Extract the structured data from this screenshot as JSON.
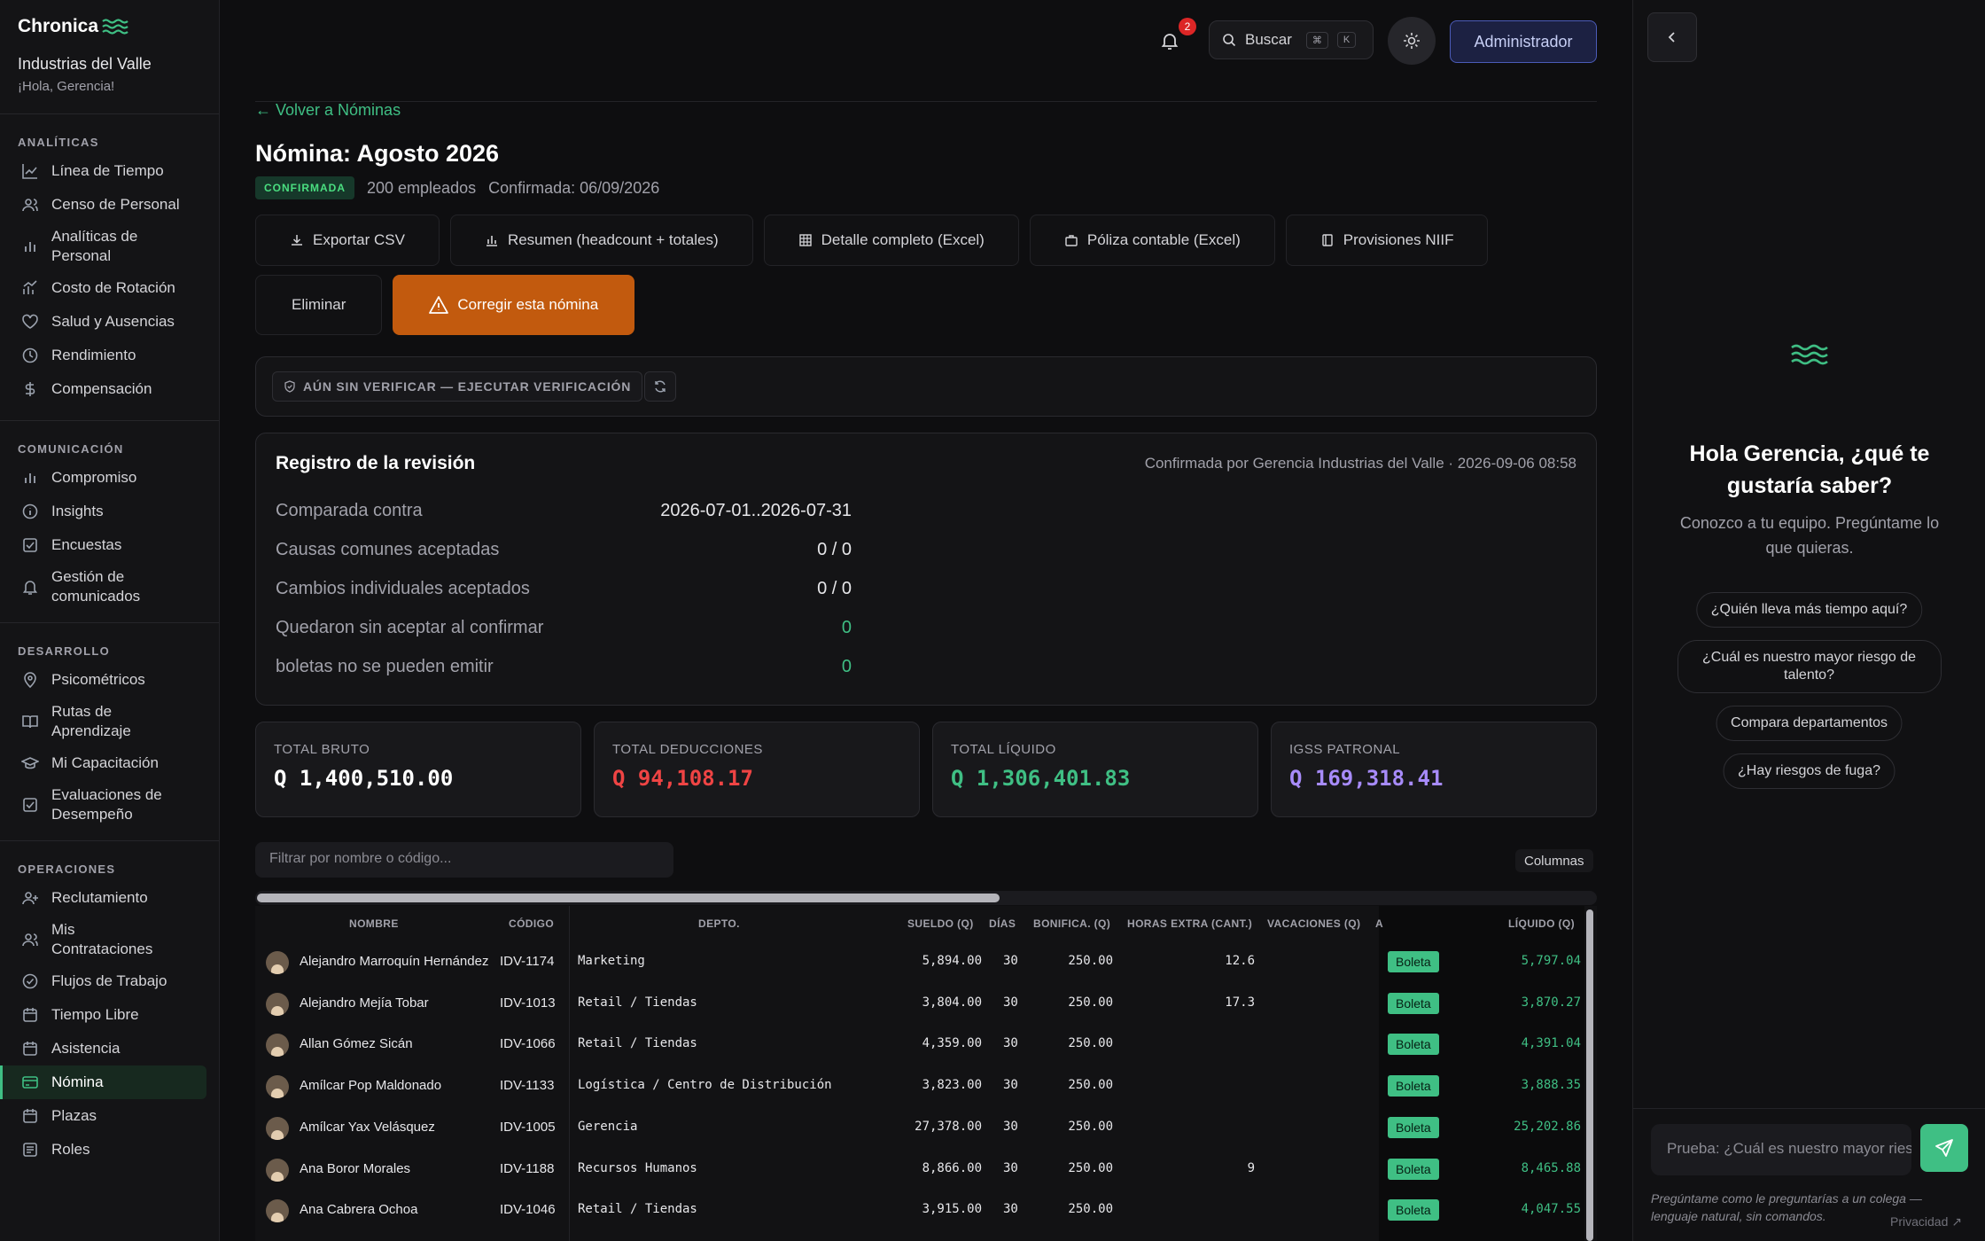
{
  "sidebar": {
    "brand": "Chronica",
    "company": "Industrias del Valle",
    "greeting": "¡Hola, Gerencia!",
    "sections": [
      {
        "title": "ANALÍTICAS",
        "items": [
          {
            "label": "Línea de Tiempo",
            "icon": "chart-line-icon"
          },
          {
            "label": "Censo de Personal",
            "icon": "users-icon"
          },
          {
            "label": "Analíticas de Personal",
            "icon": "bar-chart-icon"
          },
          {
            "label": "Costo de Rotación",
            "icon": "trend-icon"
          },
          {
            "label": "Salud y Ausencias",
            "icon": "heart-icon"
          },
          {
            "label": "Rendimiento",
            "icon": "clock-icon"
          },
          {
            "label": "Compensación",
            "icon": "dollar-icon"
          }
        ]
      },
      {
        "title": "COMUNICACIÓN",
        "items": [
          {
            "label": "Compromiso",
            "icon": "bar-chart-icon"
          },
          {
            "label": "Insights",
            "icon": "info-icon"
          },
          {
            "label": "Encuestas",
            "icon": "checkbox-icon"
          },
          {
            "label": "Gestión de comunicados",
            "icon": "bell-icon"
          }
        ]
      },
      {
        "title": "DESARROLLO",
        "items": [
          {
            "label": "Psicométricos",
            "icon": "pin-icon"
          },
          {
            "label": "Rutas de Aprendizaje",
            "icon": "book-icon"
          },
          {
            "label": "Mi Capacitación",
            "icon": "graduation-icon"
          },
          {
            "label": "Evaluaciones de Desempeño",
            "icon": "checkbox-icon"
          }
        ]
      },
      {
        "title": "OPERACIONES",
        "items": [
          {
            "label": "Reclutamiento",
            "icon": "user-plus-icon"
          },
          {
            "label": "Mis Contrataciones",
            "icon": "users-icon"
          },
          {
            "label": "Flujos de Trabajo",
            "icon": "check-circle-icon"
          },
          {
            "label": "Tiempo Libre",
            "icon": "calendar-icon"
          },
          {
            "label": "Asistencia",
            "icon": "calendar-icon"
          },
          {
            "label": "Nómina",
            "icon": "card-icon",
            "active": true
          },
          {
            "label": "Plazas",
            "icon": "calendar-icon"
          },
          {
            "label": "Roles",
            "icon": "list-icon"
          }
        ]
      }
    ]
  },
  "topbar": {
    "notifications": "2",
    "search_label": "Buscar",
    "kbd1": "⌘",
    "kbd2": "K",
    "admin_label": "Administrador"
  },
  "page": {
    "back": "← Volver a Nóminas",
    "title": "Nómina: Agosto 2026",
    "status": "CONFIRMADA",
    "employees": "200 empleados",
    "confirmed": "Confirmada: 06/09/2026",
    "actions": [
      {
        "label": "Exportar CSV",
        "icon": "download-icon"
      },
      {
        "label": "Resumen (headcount + totales)",
        "icon": "bar-chart-icon"
      },
      {
        "label": "Detalle completo (Excel)",
        "icon": "table-icon"
      },
      {
        "label": "Póliza contable (Excel)",
        "icon": "briefcase-icon"
      },
      {
        "label": "Provisiones NIIF",
        "icon": "book-icon"
      }
    ],
    "delete_label": "Eliminar",
    "fix_label": "Corregir esta nómina",
    "verify_label": "AÚN SIN VERIFICAR — EJECUTAR VERIFICACIÓN"
  },
  "review": {
    "title": "Registro de la revisión",
    "by": "Confirmada por Gerencia Industrias del Valle · 2026-09-06 08:58",
    "rows": [
      {
        "label": "Comparada contra",
        "value": "2026-07-01..2026-07-31"
      },
      {
        "label": "Causas comunes aceptadas",
        "value": "0 / 0"
      },
      {
        "label": "Cambios individuales aceptados",
        "value": "0 / 0"
      },
      {
        "label": "Quedaron sin aceptar al confirmar",
        "value": "0"
      },
      {
        "label": "boletas no se pueden emitir",
        "value": "0"
      }
    ]
  },
  "stats": [
    {
      "label": "TOTAL BRUTO",
      "value": "Q 1,400,510.00",
      "color": "#ffffff"
    },
    {
      "label": "TOTAL DEDUCCIONES",
      "value": "Q 94,108.17",
      "color": "#ef4444"
    },
    {
      "label": "TOTAL LÍQUIDO",
      "value": "Q 1,306,401.83",
      "color": "#3fbf84"
    },
    {
      "label": "IGSS PATRONAL",
      "value": "Q 169,318.41",
      "color": "#a78bfa"
    }
  ],
  "table": {
    "filter_placeholder": "Filtrar por nombre o código...",
    "columns_label": "Columnas",
    "headers": [
      "NOMBRE",
      "CÓDIGO",
      "DEPTO.",
      "SUELDO (Q)",
      "DÍAS",
      "BONIFICA. (Q)",
      "HORAS EXTRA (CANT.)",
      "VACACIONES (Q)",
      "A",
      "LÍQUIDO (Q)"
    ],
    "boleta_label": "Boleta",
    "rows": [
      {
        "name": "Alejandro Marroquín Hernández",
        "code": "IDV-1174",
        "dept": "Marketing",
        "salary": "5,894.00",
        "days": "30",
        "bonus": "250.00",
        "overtime": "12.6",
        "net": "5,797.04"
      },
      {
        "name": "Alejandro Mejía Tobar",
        "code": "IDV-1013",
        "dept": "Retail / Tiendas",
        "salary": "3,804.00",
        "days": "30",
        "bonus": "250.00",
        "overtime": "17.3",
        "net": "3,870.27"
      },
      {
        "name": "Allan Gómez Sicán",
        "code": "IDV-1066",
        "dept": "Retail / Tiendas",
        "salary": "4,359.00",
        "days": "30",
        "bonus": "250.00",
        "overtime": "",
        "net": "4,391.04"
      },
      {
        "name": "Amílcar Pop Maldonado",
        "code": "IDV-1133",
        "dept": "Logística / Centro de Distribución",
        "salary": "3,823.00",
        "days": "30",
        "bonus": "250.00",
        "overtime": "",
        "net": "3,888.35"
      },
      {
        "name": "Amílcar Yax Velásquez",
        "code": "IDV-1005",
        "dept": "Gerencia",
        "salary": "27,378.00",
        "days": "30",
        "bonus": "250.00",
        "overtime": "",
        "net": "25,202.86"
      },
      {
        "name": "Ana Boror Morales",
        "code": "IDV-1188",
        "dept": "Recursos Humanos",
        "salary": "8,866.00",
        "days": "30",
        "bonus": "250.00",
        "overtime": "9",
        "net": "8,465.88"
      },
      {
        "name": "Ana Cabrera Ochoa",
        "code": "IDV-1046",
        "dept": "Retail / Tiendas",
        "salary": "3,915.00",
        "days": "30",
        "bonus": "250.00",
        "overtime": "",
        "net": "4,047.55"
      }
    ]
  },
  "chat": {
    "hello": "Hola Gerencia, ¿qué te gustaría saber?",
    "sub": "Conozco a tu equipo. Pregúntame lo que quieras.",
    "suggestions": [
      "¿Quién lleva más tiempo aquí?",
      "¿Cuál es nuestro mayor riesgo de talento?",
      "Compara departamentos",
      "¿Hay riesgos de fuga?"
    ],
    "input_placeholder": "Prueba: ¿Cuál es nuestro mayor riesgo de talento?",
    "note": "Pregúntame como le preguntarías a un colega — lenguaje natural, sin comandos.",
    "privacy": "Privacidad"
  }
}
